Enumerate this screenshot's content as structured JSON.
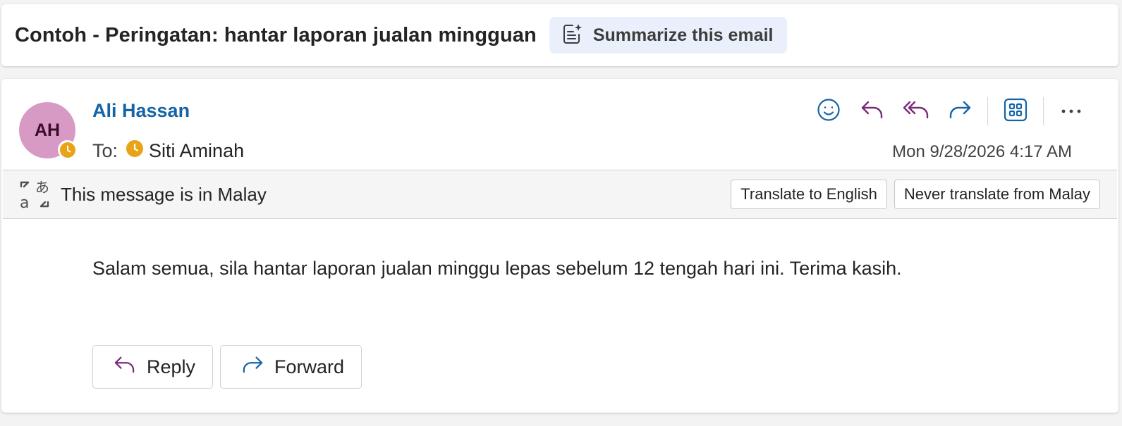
{
  "subject": {
    "title": "Contoh - Peringatan: hantar laporan jualan mingguan",
    "summarize_label": "Summarize this email",
    "summarize_icon": "copilot-summary-icon"
  },
  "message": {
    "avatar_initials": "AH",
    "avatar_color": "#d79ac4",
    "sender_name": "Ali Hassan",
    "to_label": "To:",
    "recipient_name": "Siti Aminah",
    "timestamp": "Mon 9/28/2026 4:17 AM",
    "actions": [
      "emoji-icon",
      "reply-icon",
      "reply-all-icon",
      "forward-icon",
      "apps-icon",
      "more-icon"
    ],
    "accent_color": "#1464a8",
    "reply_color": "#7a2a78"
  },
  "translate_bar": {
    "text": "This message is in Malay",
    "translate_label": "Translate to English",
    "never_label": "Never translate from Malay"
  },
  "body": {
    "text": "Salam semua, sila hantar laporan jualan minggu lepas sebelum 12 tengah hari ini. Terima kasih."
  },
  "footer": {
    "reply_label": "Reply",
    "forward_label": "Forward"
  }
}
